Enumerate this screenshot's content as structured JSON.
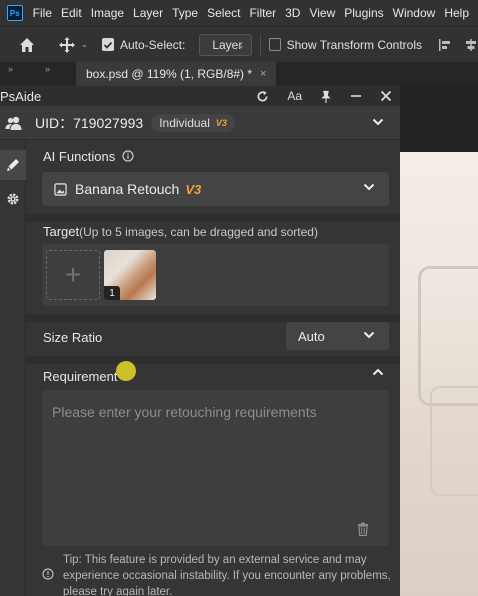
{
  "menubar": {
    "logo": "Ps",
    "items": [
      "File",
      "Edit",
      "Image",
      "Layer",
      "Type",
      "Select",
      "Filter",
      "3D",
      "View",
      "Plugins",
      "Window",
      "Help"
    ]
  },
  "options_bar": {
    "auto_select_label": "Auto-Select:",
    "auto_select_checked": true,
    "layer_value": "Layer",
    "show_transform_label": "Show Transform Controls",
    "show_transform_checked": false
  },
  "tabbar": {
    "collapse_left": "»",
    "collapse_mid": "»",
    "doc_tab": "box.psd @ 119% (1, RGB/8#) *",
    "close_glyph": "×"
  },
  "panel": {
    "title": "PsAide",
    "header_controls": [
      "refresh-icon",
      "font-size-icon",
      "pin-icon",
      "minimize-icon",
      "close-icon"
    ],
    "font_size_glyph": "Aa",
    "user": {
      "uid_text": "UID：719027993",
      "plan_badge": "Individual",
      "plan_version": "V3"
    },
    "ai_functions": {
      "label": "AI Functions",
      "selected": "Banana Retouch",
      "selected_version": "V3"
    },
    "target": {
      "label": "Target",
      "hint": "(Up to 5 images, can be dragged and sorted)",
      "add_glyph": "+",
      "images": [
        {
          "index": "1"
        }
      ]
    },
    "size_ratio": {
      "label": "Size Ratio",
      "value": "Auto"
    },
    "requirement": {
      "label": "Requirement",
      "placeholder": "Please enter your retouching requirements"
    },
    "tip": "Tip: This feature is provided by an external service and may experience occasional instability. If you encounter any problems, please try again later."
  },
  "colors": {
    "accent_version": "#f0a33a",
    "panel_bg": "#353535",
    "ps_blue": "#31a8ff"
  }
}
